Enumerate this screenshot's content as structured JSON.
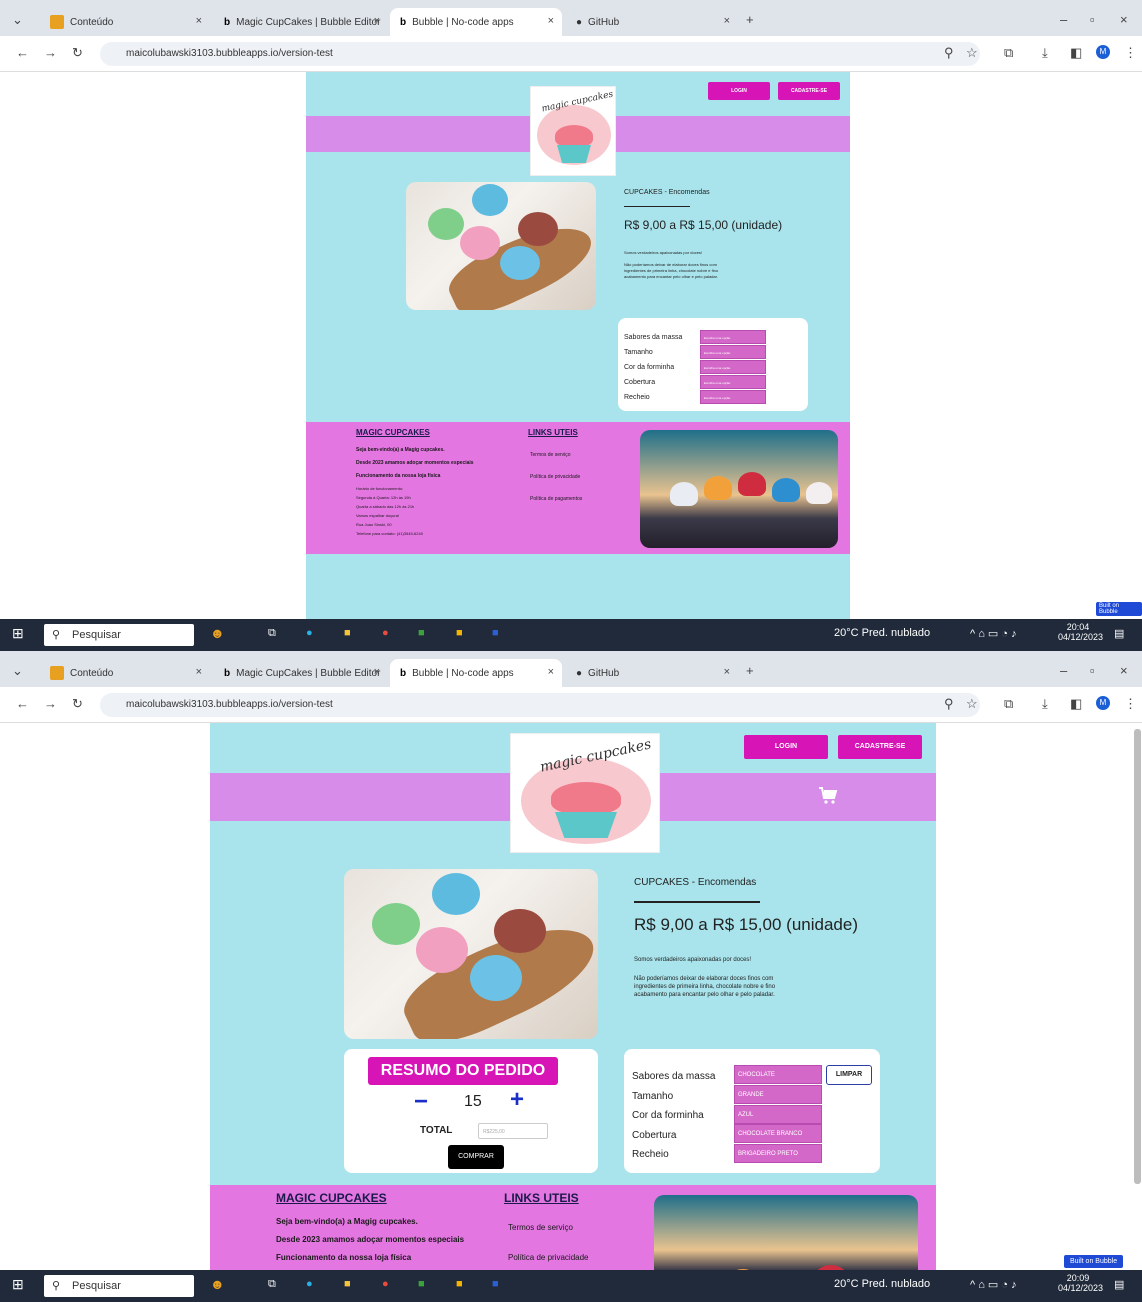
{
  "browser": {
    "tabs": [
      {
        "label": "Conteúdo"
      },
      {
        "label": "Magic CupCakes | Bubble Editor"
      },
      {
        "label": "Bubble | No-code apps"
      },
      {
        "label": "GitHub"
      }
    ],
    "new_tab": "+",
    "url": "maicolubawski3103.bubbleapps.io/version-test",
    "profile_initial": "M"
  },
  "site": {
    "logo_text": "magic cupcakes",
    "login_label": "LOGIN",
    "signup_label": "CADASTRE-SE",
    "product": {
      "title": "CUPCAKES - Encomendas",
      "price": "R$ 9,00 a R$ 15,00  (unidade)",
      "tagline": "Somos verdadeiros apaixonadas por doces!",
      "description": "Não poderíamos deixar de elaborar doces finos com ingredientes de primeira linha, chocolate nobre e fino acabamento para encantar pelo olhar e pelo paladar."
    },
    "options": {
      "labels": [
        "Sabores da massa",
        "Tamanho",
        "Cor da forminha",
        "Cobertura",
        "Recheio"
      ],
      "placeholder": "Escolha uma opção",
      "selected": [
        "CHOCOLATE",
        "GRANDE",
        "AZUL",
        "CHOCOLATE BRANCO",
        "BRIGADEIRO PRETO"
      ],
      "clear_label": "LIMPAR"
    },
    "order": {
      "title": "RESUMO DO PEDIDO",
      "minus": "−",
      "plus": "+",
      "quantity": "15",
      "total_label": "TOTAL",
      "total_value": "R$225,00",
      "buy_label": "COMPRAR"
    },
    "footer": {
      "col1_title": "MAGIC CUPCAKES",
      "welcome": "Seja bem-vindo(a) a Magig cupcakes.",
      "since": "Desde 2023 amamos adoçar momentos especiais",
      "store_title": "Funcionamento da nossa loja física",
      "hours_title": "Horário de funcionamento:",
      "hours1": "Segunda à Quarta: 12h às 19h",
      "hours2": "Quarta a sábado das 12h às 21h",
      "spread": "Vamos espalhar doçura!",
      "address": "Rua Joao Sinski, 00",
      "phone": "Telefone para contato: (41)3545-6240",
      "col2_title": "LINKS UTEIS",
      "links": [
        "Termos de serviço",
        "Política de privacidade",
        "Política de pagamentos"
      ]
    },
    "built_on": "Built on Bubble"
  },
  "taskbar": {
    "search": "Pesquisar",
    "weather": "20°C  Pred. nublado",
    "time_1": "20:04",
    "date_1": "04/12/2023",
    "time_2": "20:09",
    "date_2": "04/12/2023"
  }
}
